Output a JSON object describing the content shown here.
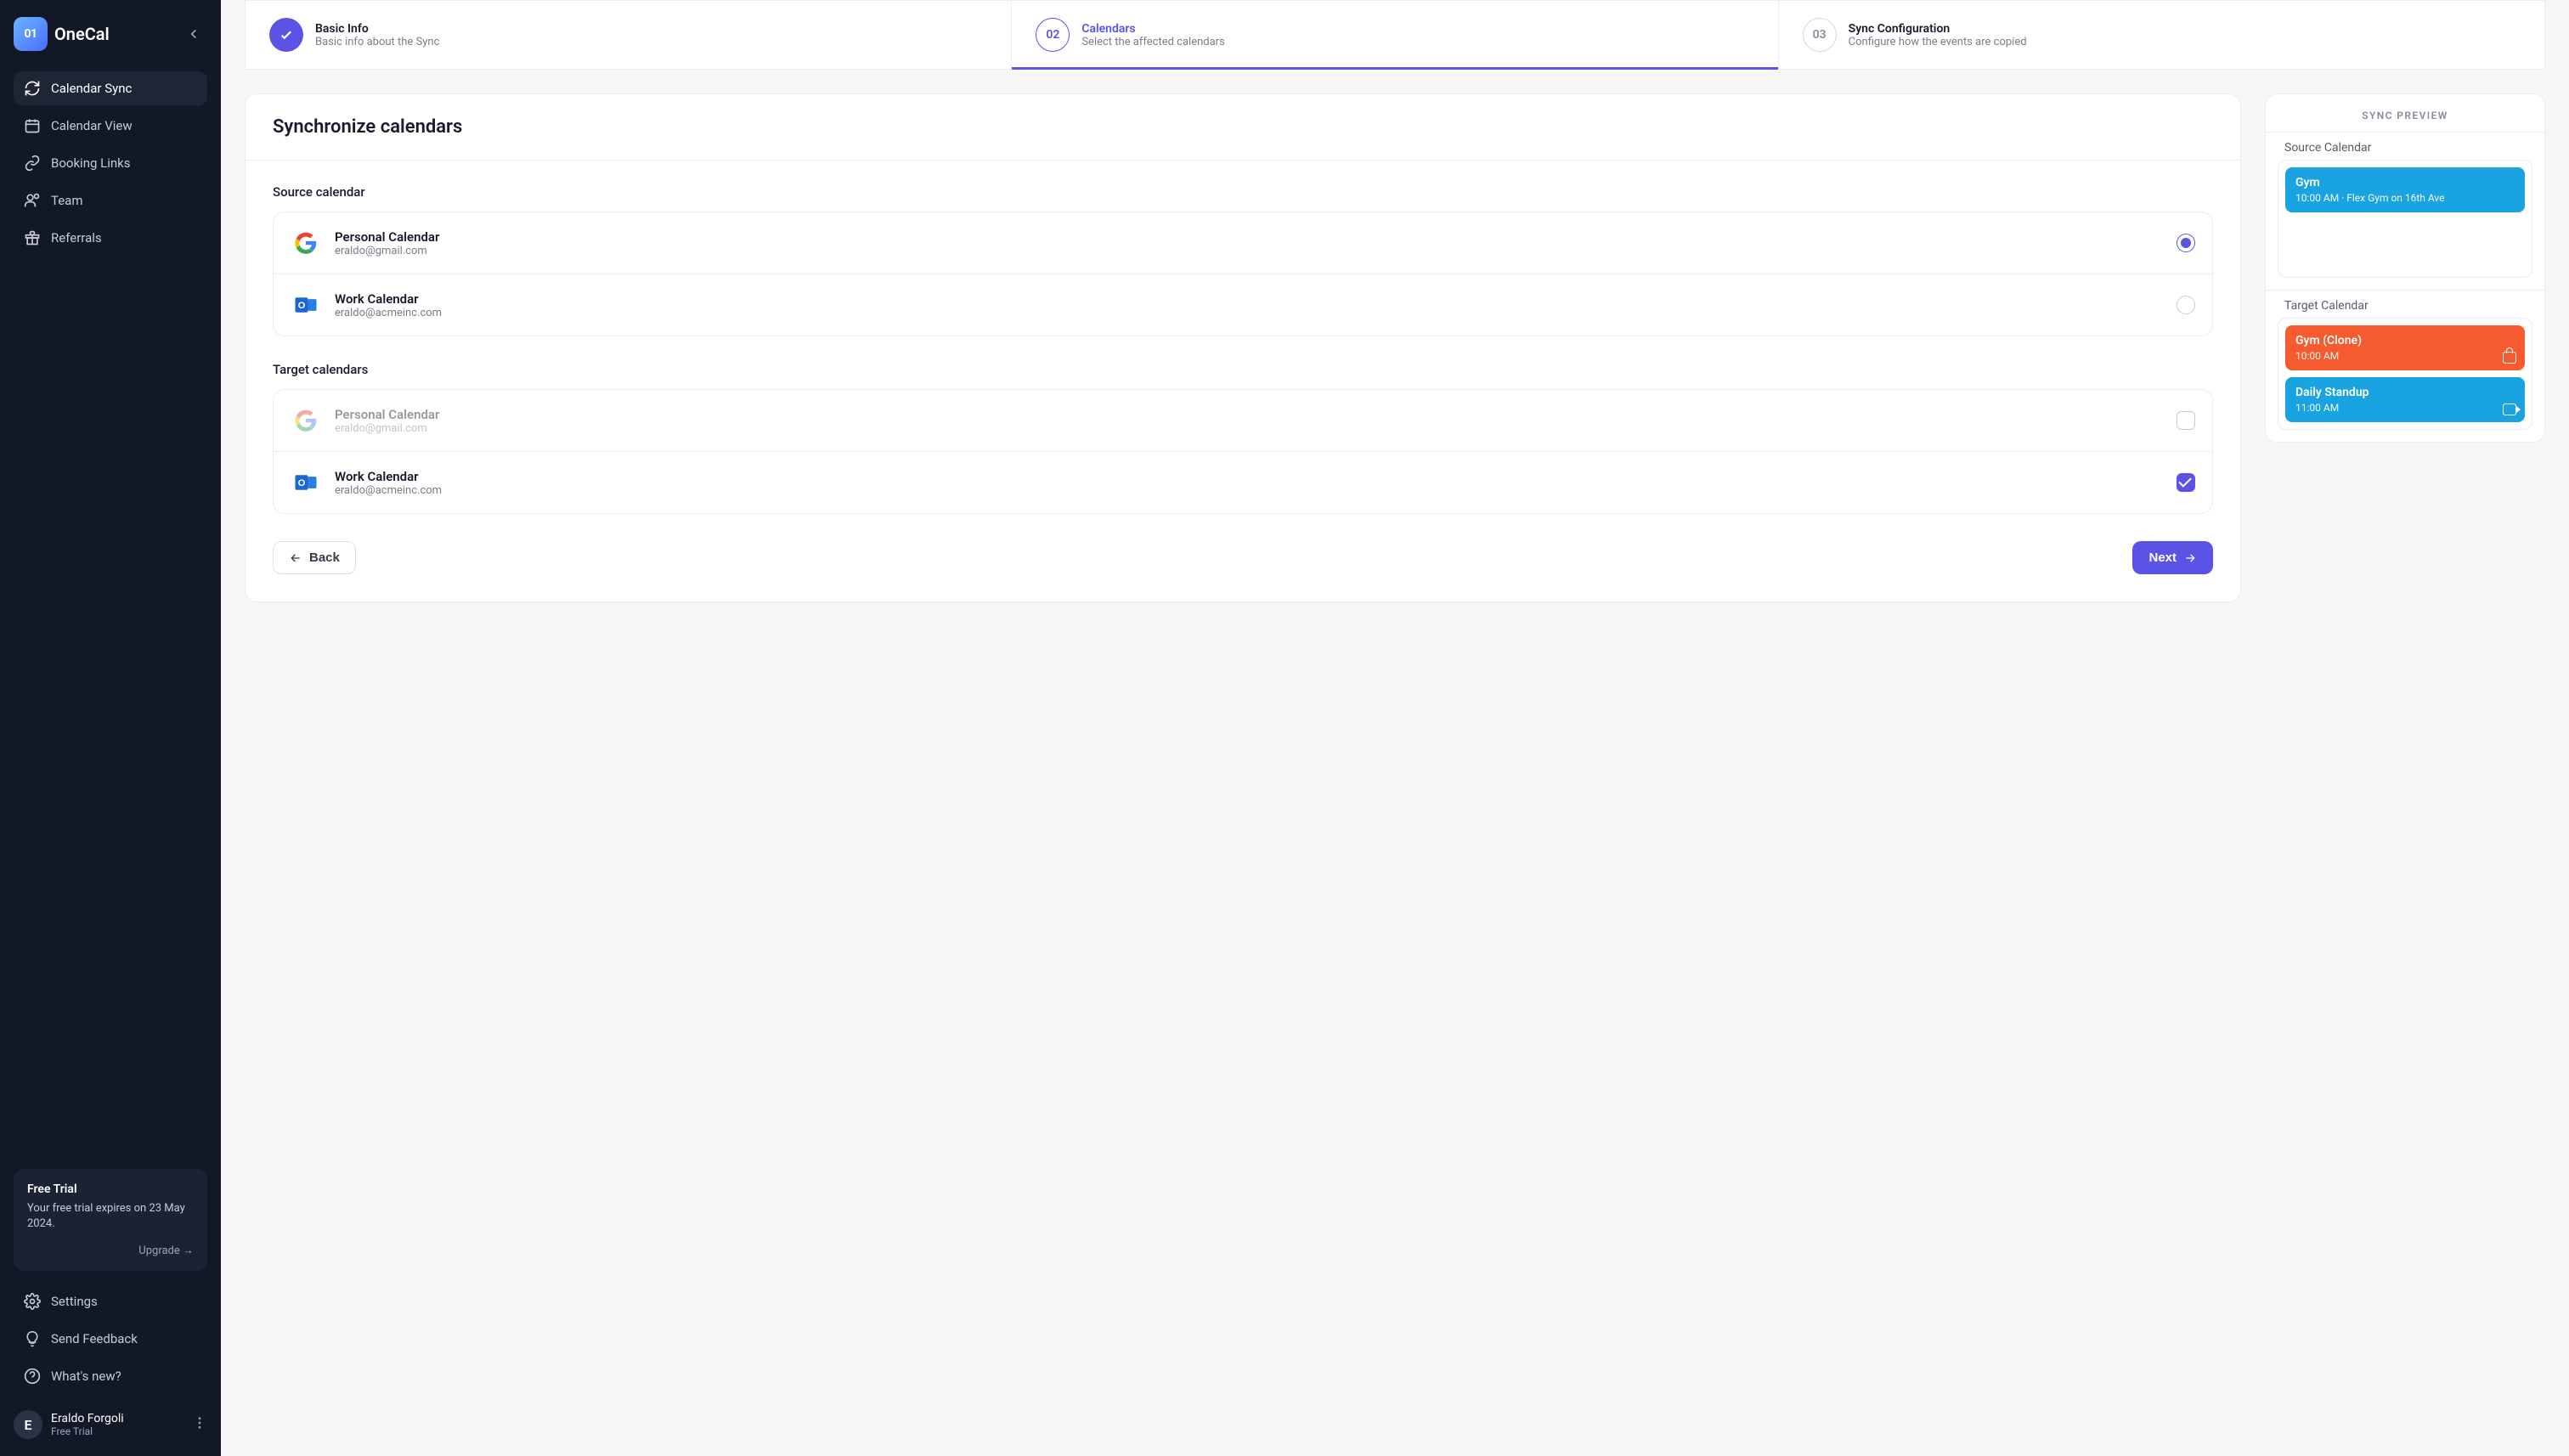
{
  "brand": {
    "mark": "01",
    "name": "OneCal"
  },
  "nav": {
    "items": [
      {
        "label": "Calendar Sync"
      },
      {
        "label": "Calendar View"
      },
      {
        "label": "Booking Links"
      },
      {
        "label": "Team"
      },
      {
        "label": "Referrals"
      }
    ]
  },
  "trial": {
    "title": "Free Trial",
    "expires": "Your free trial expires on 23 May 2024.",
    "upgrade": "Upgrade →"
  },
  "footer_nav": {
    "settings": "Settings",
    "feedback": "Send Feedback",
    "whatsnew": "What's new?"
  },
  "user": {
    "initial": "E",
    "name": "Eraldo Forgoli",
    "plan": "Free Trial"
  },
  "stepper": {
    "s1": {
      "title": "Basic Info",
      "sub": "Basic info about the Sync"
    },
    "s2": {
      "num": "02",
      "title": "Calendars",
      "sub": "Select the affected calendars"
    },
    "s3": {
      "num": "03",
      "title": "Sync Configuration",
      "sub": "Configure how the events are copied"
    }
  },
  "main": {
    "heading": "Synchronize calendars",
    "source_label": "Source calendar",
    "target_label": "Target calendars",
    "calendars": {
      "src": [
        {
          "name": "Personal Calendar",
          "email": "eraldo@gmail.com"
        },
        {
          "name": "Work Calendar",
          "email": "eraldo@acmeinc.com"
        }
      ],
      "tgt": [
        {
          "name": "Personal Calendar",
          "email": "eraldo@gmail.com"
        },
        {
          "name": "Work Calendar",
          "email": "eraldo@acmeinc.com"
        }
      ]
    },
    "back": "Back",
    "next": "Next"
  },
  "preview": {
    "title": "SYNC PREVIEW",
    "source_title": "Source Calendar",
    "target_title": "Target Calendar",
    "source_event": {
      "title": "Gym",
      "sub": "10:00 AM · Flex Gym on 16th Ave"
    },
    "target_events": [
      {
        "title": "Gym (Clone)",
        "sub": "10:00 AM"
      },
      {
        "title": "Daily Standup",
        "sub": "11:00 AM"
      }
    ]
  }
}
